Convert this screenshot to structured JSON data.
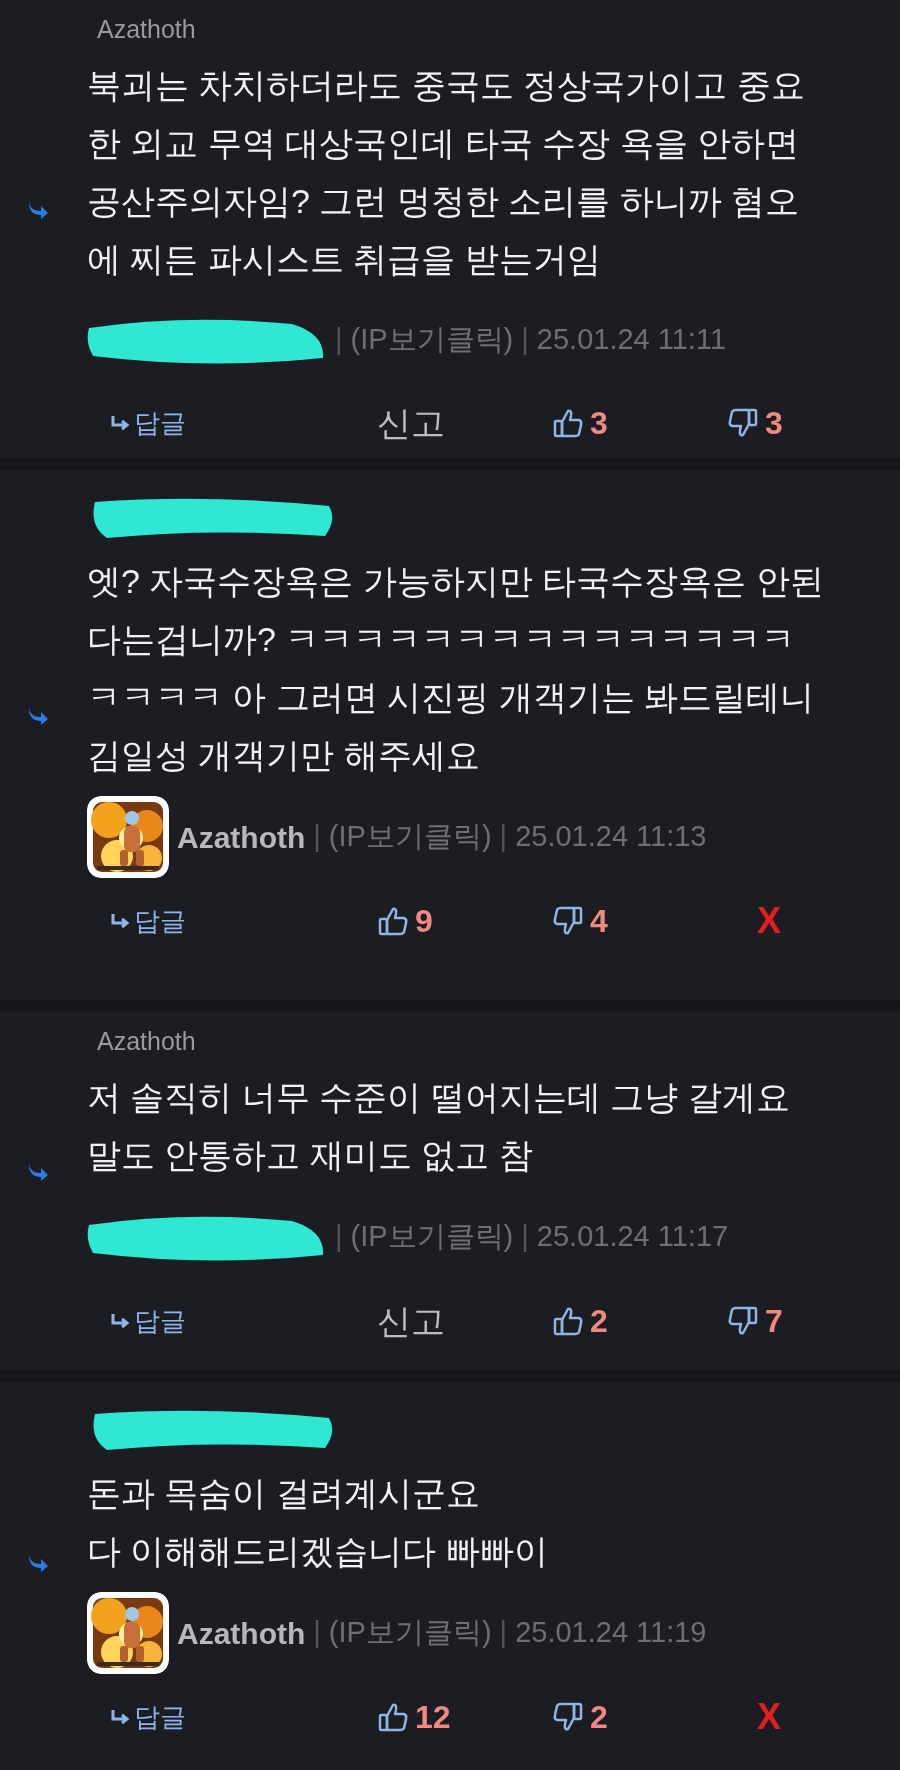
{
  "comments": [
    {
      "header": {
        "kind": "name",
        "text": "Azathoth"
      },
      "body": [
        "북괴는 차치하더라도 중국도 정상국가이고 중요",
        "한 외교 무역 대상국인데 타국 수장 욕을 안하면",
        "공산주의자임? 그런 멍청한 소리를 하니까 혐오",
        "에 찌든 파시스트 취급을 받는거임"
      ],
      "meta": {
        "author": {
          "kind": "redacted"
        },
        "divider": "|",
        "ip": "(IP보기클릭)",
        "date": "25.01.24 11:11"
      },
      "actions": [
        {
          "kind": "reply",
          "text": "답글"
        },
        {
          "kind": "report",
          "text": "신고"
        },
        {
          "kind": "like",
          "text": "3"
        },
        {
          "kind": "dislike",
          "text": "3"
        }
      ]
    },
    {
      "header": {
        "kind": "redacted"
      },
      "body": [
        "엣? 자국수장욕은 가능하지만 타국수장욕은 안된",
        "다는겁니까? ㅋㅋㅋㅋㅋㅋㅋㅋㅋㅋㅋㅋㅋㅋㅋ",
        "ㅋㅋㅋㅋ 아 그러면 시진핑 개객기는 봐드릴테니",
        "김일성 개객기만 해주세요"
      ],
      "meta": {
        "author": {
          "kind": "avatar",
          "name": "Azathoth"
        },
        "divider": "|",
        "ip": "(IP보기클릭)",
        "date": "25.01.24 11:13"
      },
      "actions": [
        {
          "kind": "reply",
          "text": "답글"
        },
        {
          "kind": "like",
          "text": "9"
        },
        {
          "kind": "dislike",
          "text": "4"
        },
        {
          "kind": "delete",
          "text": "X"
        }
      ]
    },
    {
      "header": {
        "kind": "name",
        "text": "Azathoth"
      },
      "body": [
        "저 솔직히 너무 수준이 떨어지는데 그냥 갈게요",
        "말도 안통하고 재미도 없고 참"
      ],
      "meta": {
        "author": {
          "kind": "redacted"
        },
        "divider": "|",
        "ip": "(IP보기클릭)",
        "date": "25.01.24 11:17"
      },
      "actions": [
        {
          "kind": "reply",
          "text": "답글"
        },
        {
          "kind": "report",
          "text": "신고"
        },
        {
          "kind": "like",
          "text": "2"
        },
        {
          "kind": "dislike",
          "text": "7"
        }
      ]
    },
    {
      "header": {
        "kind": "redacted"
      },
      "body": [
        "돈과 목숨이 걸려계시군요",
        "다 이해해드리겠습니다 빠빠이"
      ],
      "meta": {
        "author": {
          "kind": "avatar",
          "name": "Azathoth"
        },
        "divider": "|",
        "ip": "(IP보기클릭)",
        "date": "25.01.24 11:19"
      },
      "actions": [
        {
          "kind": "reply",
          "text": "답글"
        },
        {
          "kind": "like",
          "text": "12"
        },
        {
          "kind": "dislike",
          "text": "2"
        },
        {
          "kind": "delete",
          "text": "X"
        }
      ]
    }
  ]
}
